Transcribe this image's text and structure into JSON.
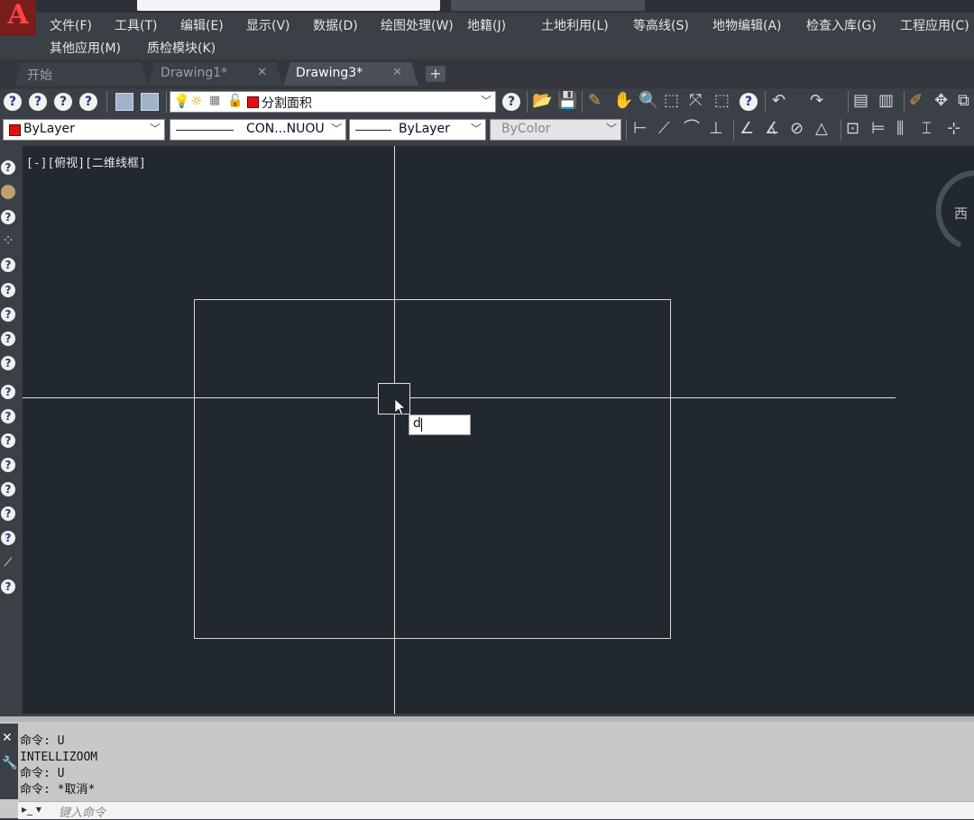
{
  "app": {
    "logo_text": "A"
  },
  "menubar": {
    "row1": [
      "文件(F)",
      "工具(T)",
      "编辑(E)",
      "显示(V)",
      "数据(D)",
      "绘图处理(W)",
      "地籍(J)",
      "土地利用(L)",
      "等高线(S)",
      "地物编辑(A)",
      "检查入库(G)",
      "工程应用(C)"
    ],
    "row2": [
      "其他应用(M)",
      "质检模块(K)"
    ]
  },
  "tabs": [
    {
      "label": "开始"
    },
    {
      "label": "Drawing1*",
      "close": "✕"
    },
    {
      "label": "Drawing3*",
      "close": "✕"
    }
  ],
  "tab_add": "+",
  "toolbar1": {
    "layer_name": "分割面积"
  },
  "toolbar2": {
    "color": "ByLayer",
    "linetype": "CON...NUOU",
    "lineweight": "ByLayer",
    "plotstyle": "ByColor"
  },
  "colors": {
    "canvas_bg": "#212830",
    "ui_bg": "#3b3f46",
    "layer_color": "#e01010"
  },
  "viewport": {
    "label": "[-][俯视][二维线框]",
    "viewcube_letter": "西"
  },
  "dynamic_input": {
    "value": "d"
  },
  "command_line": {
    "history": [
      "命令:  U",
      "INTELLIZOOM",
      "命令:  U",
      "命令: *取消*"
    ],
    "placeholder": "键入命令"
  }
}
